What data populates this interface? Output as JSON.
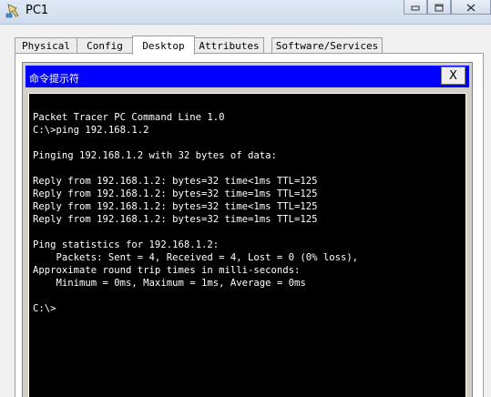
{
  "window": {
    "title": "PC1",
    "icon": "pc-icon",
    "controls": {
      "minimize_icon": "minimize-icon",
      "maximize_icon": "maximize-icon",
      "close_icon": "close-icon"
    }
  },
  "tabs": [
    {
      "label": "Physical",
      "active": false
    },
    {
      "label": "Config",
      "active": false
    },
    {
      "label": "Desktop",
      "active": true
    },
    {
      "label": "Attributes",
      "active": false
    },
    {
      "label": "Software/Services",
      "active": false
    }
  ],
  "command_prompt": {
    "title": "命令提示符",
    "close_label": "X",
    "title_bar_color": "#0000ff",
    "lines": [
      "Packet Tracer PC Command Line 1.0",
      "C:\\>ping 192.168.1.2",
      "",
      "Pinging 192.168.1.2 with 32 bytes of data:",
      "",
      "Reply from 192.168.1.2: bytes=32 time<1ms TTL=125",
      "Reply from 192.168.1.2: bytes=32 time=1ms TTL=125",
      "Reply from 192.168.1.2: bytes=32 time<1ms TTL=125",
      "Reply from 192.168.1.2: bytes=32 time=1ms TTL=125",
      "",
      "Ping statistics for 192.168.1.2:",
      "    Packets: Sent = 4, Received = 4, Lost = 0 (0% loss),",
      "Approximate round trip times in milli-seconds:",
      "    Minimum = 0ms, Maximum = 1ms, Average = 0ms",
      "",
      "C:\\>"
    ]
  }
}
